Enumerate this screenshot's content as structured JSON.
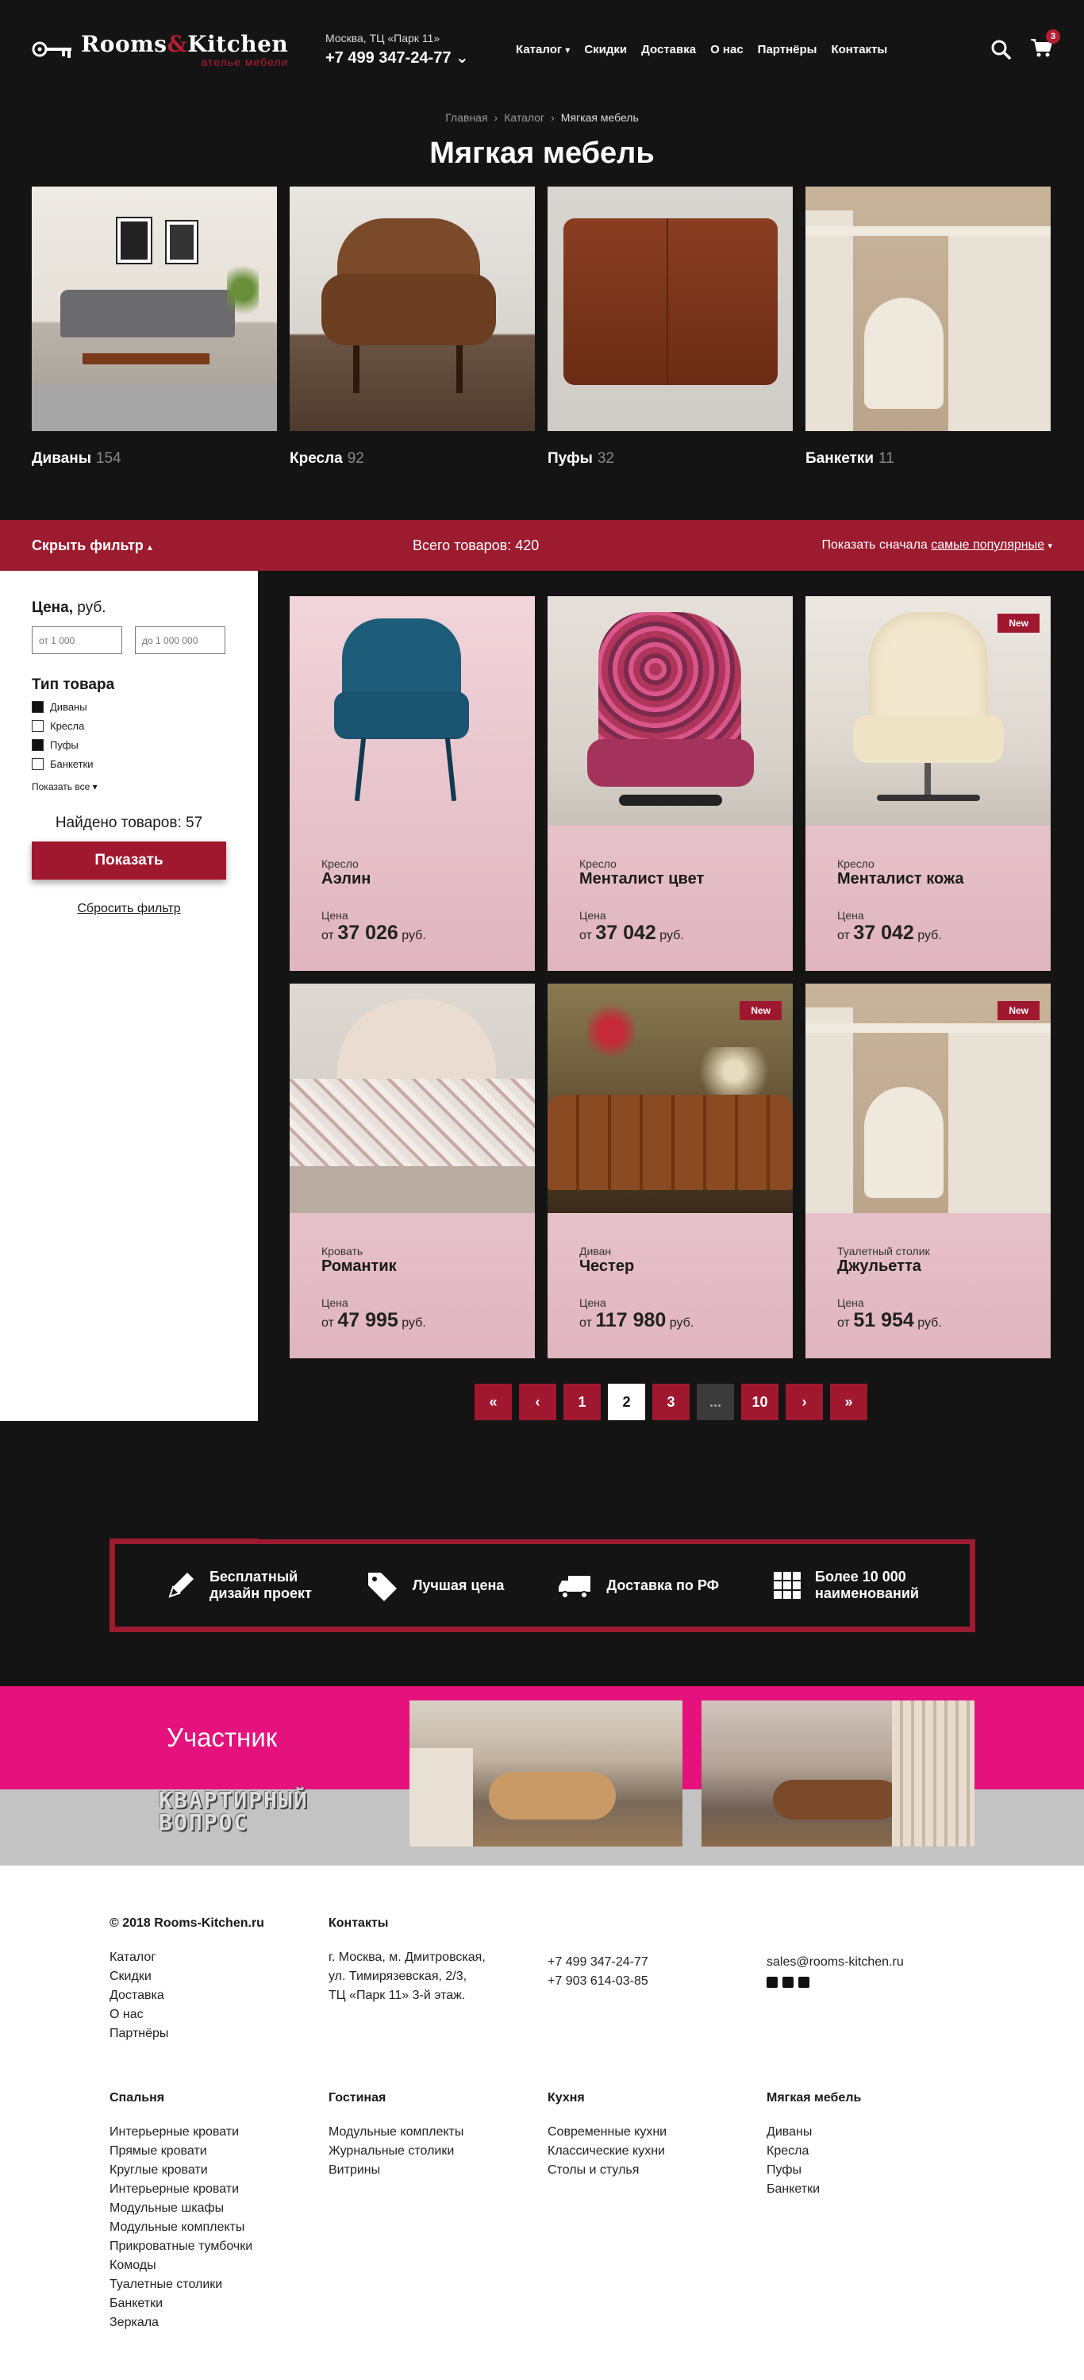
{
  "header": {
    "logo_main_1": "Rooms",
    "logo_amp": "&",
    "logo_main_2": "Kitchen",
    "logo_sub": "ателье мебели",
    "address": "Москва, ТЦ «Парк 11»",
    "phone": "+7 499 347-24-77",
    "nav": [
      "Каталог",
      "Скидки",
      "Доставка",
      "О нас",
      "Партнёры",
      "Контакты"
    ],
    "cart_count": "3"
  },
  "breadcrumb": [
    "Главная",
    "Каталог",
    "Мягкая мебель"
  ],
  "page_title": "Мягкая мебель",
  "categories": [
    {
      "name": "Диваны",
      "count": "154"
    },
    {
      "name": "Кресла",
      "count": "92"
    },
    {
      "name": "Пуфы",
      "count": "32"
    },
    {
      "name": "Банкетки",
      "count": "11"
    }
  ],
  "filterbar": {
    "toggle": "Скрыть фильтр",
    "total": "Всего товаров: 420",
    "sort_prefix": "Показать сначала",
    "sort_value": "самые популярные"
  },
  "filter": {
    "price_title": "Цена,",
    "price_unit": "руб.",
    "price_from_placeholder": "от 1 000",
    "price_to_placeholder": "до 1 000 000",
    "type_title": "Тип товара",
    "types": [
      {
        "label": "Диваны",
        "checked": true
      },
      {
        "label": "Кресла",
        "checked": false
      },
      {
        "label": "Пуфы",
        "checked": true
      },
      {
        "label": "Банкетки",
        "checked": false
      }
    ],
    "show_all": "Показать все",
    "found": "Найдено товаров: 57",
    "show_button": "Показать",
    "reset": "Сбросить фильтр"
  },
  "products": [
    {
      "type": "Кресло",
      "name": "Аэлин",
      "price_label": "Цена",
      "from": "от",
      "price": "37 026",
      "currency": "руб.",
      "is_new": false
    },
    {
      "type": "Кресло",
      "name": "Менталист цвет",
      "price_label": "Цена",
      "from": "от",
      "price": "37 042",
      "currency": "руб.",
      "is_new": false
    },
    {
      "type": "Кресло",
      "name": "Менталист кожа",
      "price_label": "Цена",
      "from": "от",
      "price": "37 042",
      "currency": "руб.",
      "is_new": true
    },
    {
      "type": "Кровать",
      "name": "Романтик",
      "price_label": "Цена",
      "from": "от",
      "price": "47 995",
      "currency": "руб.",
      "is_new": false
    },
    {
      "type": "Диван",
      "name": "Честер",
      "price_label": "Цена",
      "from": "от",
      "price": "117 980",
      "currency": "руб.",
      "is_new": true
    },
    {
      "type": "Туалетный столик",
      "name": "Джульетта",
      "price_label": "Цена",
      "from": "от",
      "price": "51 954",
      "currency": "руб.",
      "is_new": true
    }
  ],
  "new_badge": "New",
  "pagination": {
    "first": "«",
    "prev": "‹",
    "pages": [
      "1",
      "2",
      "3",
      "...",
      "10"
    ],
    "current": "2",
    "next": "›",
    "last": "»"
  },
  "features": [
    {
      "icon": "pencil-icon",
      "line1": "Бесплатный",
      "line2": "дизайн проект"
    },
    {
      "icon": "price-tag-icon",
      "line1": "Лучшая цена",
      "line2": ""
    },
    {
      "icon": "truck-icon",
      "line1": "Доставка по РФ",
      "line2": ""
    },
    {
      "icon": "grid-icon",
      "line1": "Более 10 000",
      "line2": "наименований"
    }
  ],
  "banner": {
    "title": "Участник",
    "logo_line1": "КВАРТИРНЫЙ",
    "logo_line2": "ВОПРОС"
  },
  "footer": {
    "copyright": "© 2018 Rooms-Kitchen.ru",
    "links": [
      "Каталог",
      "Скидки",
      "Доставка",
      "О нас",
      "Партнёры"
    ],
    "contacts_title": "Контакты",
    "address_lines": [
      "г. Москва, м. Дмитровская,",
      "ул. Тимирязевская, 2/3,",
      "ТЦ «Парк 11» 3-й этаж."
    ],
    "phones": [
      "+7 499 347-24-77",
      "+7 903 614-03-85"
    ],
    "email": "sales@rooms-kitchen.ru",
    "columns": [
      {
        "title": "Спальня",
        "items": [
          "Интерьерные кровати",
          "Прямые кровати",
          "Круглые кровати",
          "Интерьерные кровати",
          "Модульные шкафы",
          "Модульные комплекты",
          "Прикроватные тумбочки",
          "Комоды",
          "Туалетные столики",
          "Банкетки",
          "Зеркала"
        ]
      },
      {
        "title": "Гостиная",
        "items": [
          "Модульные комплекты",
          "Журнальные столики",
          "Витрины"
        ]
      },
      {
        "title": "Кухня",
        "items": [
          "Современные кухни",
          "Классические кухни",
          "Столы и стулья"
        ]
      },
      {
        "title": "Мягкая мебель",
        "items": [
          "Диваны",
          "Кресла",
          "Пуфы",
          "Банкетки"
        ]
      }
    ]
  },
  "colors": {
    "brand_red": "#9c1b2f",
    "dark_bg": "#141414",
    "card_pink": "#e8c4cb",
    "banner_pink": "#e5127d"
  }
}
